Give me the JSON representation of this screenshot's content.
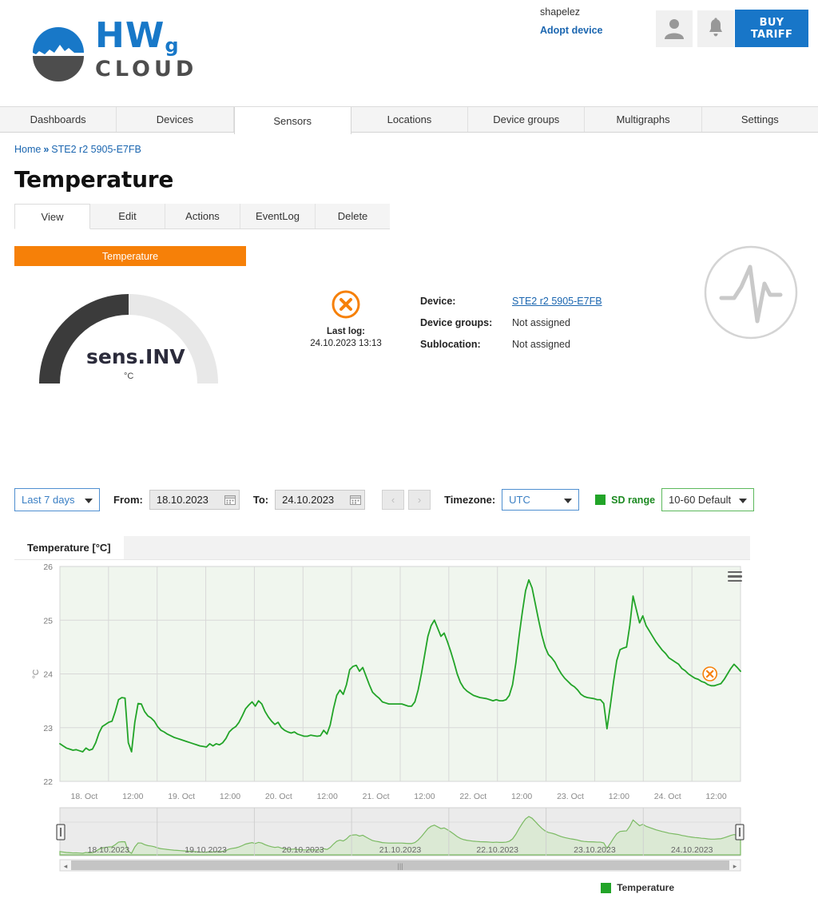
{
  "header": {
    "logo_hw": "HW",
    "logo_sub": "g",
    "logo_cloud": "CLOUD",
    "user_name": "shapelez",
    "adopt_device": "Adopt device",
    "buy_tariff": "BUY TARIFF",
    "avatar_icon": "user-icon",
    "bell_icon": "bell-icon"
  },
  "mainnav": {
    "items": [
      {
        "label": "Dashboards",
        "active": false
      },
      {
        "label": "Devices",
        "active": false
      },
      {
        "label": "Sensors",
        "active": true
      },
      {
        "label": "Locations",
        "active": false
      },
      {
        "label": "Device groups",
        "active": false
      },
      {
        "label": "Multigraphs",
        "active": false
      },
      {
        "label": "Settings",
        "active": false
      }
    ]
  },
  "breadcrumb": {
    "home": "Home",
    "separator": "»",
    "current": "STE2 r2 5905-E7FB"
  },
  "page_title": "Temperature",
  "subtabs": {
    "items": [
      {
        "label": "View",
        "active": true
      },
      {
        "label": "Edit",
        "active": false
      },
      {
        "label": "Actions",
        "active": false
      },
      {
        "label": "EventLog",
        "active": false
      },
      {
        "label": "Delete",
        "active": false
      }
    ]
  },
  "sensor_pill": "Temperature",
  "gauge": {
    "value": "sens.INV",
    "unit": "°C",
    "fill_color": "#3b3b3b",
    "track_color": "#e8e8e8"
  },
  "status": {
    "icon": "error-x-circle-icon",
    "last_log_label": "Last log:",
    "last_log_time": "24.10.2023 13:13",
    "accent_color": "#f68008"
  },
  "info": {
    "rows": [
      {
        "key": "Device:",
        "value": "STE2 r2 5905-E7FB",
        "is_link": true
      },
      {
        "key": "Device groups:",
        "value": "Not assigned",
        "is_link": false
      },
      {
        "key": "Sublocation:",
        "value": "Not assigned",
        "is_link": false
      }
    ]
  },
  "controls": {
    "range_select": "Last 7 days",
    "from_label": "From:",
    "from_value": "18.10.2023",
    "to_label": "To:",
    "to_value": "24.10.2023",
    "prev_arrow": "‹",
    "next_arrow": "›",
    "timezone_label": "Timezone:",
    "timezone_value": "UTC",
    "sd_range_label": "SD range",
    "sd_range_color": "#22a428",
    "sd_select": "10-60 Default"
  },
  "chart_tab_label": "Temperature [°C]",
  "legend": {
    "label": "Temperature",
    "color": "#22a428"
  },
  "navigator": {
    "dates": [
      "18.10.2023",
      "19.10.2023",
      "20.10.2023",
      "21.10.2023",
      "22.10.2023",
      "23.10.2023",
      "24.10.2023"
    ]
  },
  "chart_data": {
    "type": "line",
    "title": "Temperature [°C]",
    "xlabel": "",
    "ylabel": "°C",
    "ylim": [
      22,
      26
    ],
    "yticks": [
      22,
      23,
      24,
      25,
      26
    ],
    "grid": true,
    "legend_position": "bottom-right",
    "xticks": [
      "18. Oct",
      "12:00",
      "19. Oct",
      "12:00",
      "20. Oct",
      "12:00",
      "21. Oct",
      "12:00",
      "22. Oct",
      "12:00",
      "23. Oct",
      "12:00",
      "24. Oct",
      "12:00"
    ],
    "series": [
      {
        "name": "Temperature",
        "color": "#22a428",
        "values": [
          22.7,
          22.66,
          22.62,
          22.6,
          22.58,
          22.59,
          22.57,
          22.55,
          22.62,
          22.58,
          22.6,
          22.72,
          22.9,
          23.02,
          23.06,
          23.1,
          23.12,
          23.3,
          23.52,
          23.56,
          23.55,
          22.72,
          22.55,
          23.1,
          23.45,
          23.44,
          23.3,
          23.22,
          23.18,
          23.12,
          23.02,
          22.95,
          22.92,
          22.88,
          22.85,
          22.82,
          22.8,
          22.78,
          22.76,
          22.74,
          22.72,
          22.7,
          22.68,
          22.66,
          22.65,
          22.64,
          22.7,
          22.66,
          22.7,
          22.68,
          22.72,
          22.8,
          22.92,
          22.98,
          23.02,
          23.1,
          23.22,
          23.35,
          23.42,
          23.48,
          23.4,
          23.5,
          23.44,
          23.3,
          23.2,
          23.12,
          23.06,
          23.1,
          23.0,
          22.95,
          22.92,
          22.9,
          22.92,
          22.88,
          22.86,
          22.84,
          22.84,
          22.86,
          22.85,
          22.84,
          22.85,
          22.95,
          22.88,
          23.05,
          23.35,
          23.6,
          23.7,
          23.62,
          23.8,
          24.08,
          24.14,
          24.16,
          24.05,
          24.12,
          23.96,
          23.8,
          23.66,
          23.6,
          23.55,
          23.48,
          23.46,
          23.44,
          23.44,
          23.44,
          23.44,
          23.44,
          23.42,
          23.4,
          23.4,
          23.48,
          23.7,
          24.0,
          24.35,
          24.7,
          24.9,
          25.0,
          24.85,
          24.7,
          24.76,
          24.6,
          24.42,
          24.22,
          24.0,
          23.84,
          23.74,
          23.68,
          23.64,
          23.6,
          23.58,
          23.56,
          23.55,
          23.54,
          23.52,
          23.5,
          23.52,
          23.5,
          23.5,
          23.52,
          23.6,
          23.8,
          24.2,
          24.7,
          25.15,
          25.55,
          25.75,
          25.6,
          25.3,
          25.0,
          24.72,
          24.5,
          24.36,
          24.3,
          24.22,
          24.1,
          24.0,
          23.92,
          23.86,
          23.8,
          23.76,
          23.7,
          23.62,
          23.58,
          23.56,
          23.55,
          23.54,
          23.52,
          23.52,
          23.45,
          22.98,
          23.4,
          23.85,
          24.25,
          24.45,
          24.48,
          24.5,
          24.9,
          25.45,
          25.2,
          24.95,
          25.08,
          24.9,
          24.8,
          24.7,
          24.6,
          24.52,
          24.44,
          24.38,
          24.3,
          24.26,
          24.22,
          24.18,
          24.1,
          24.06,
          24.0,
          23.96,
          23.92,
          23.9,
          23.86,
          23.84,
          23.8,
          23.78,
          23.78,
          23.8,
          23.82,
          23.9,
          24.0,
          24.1,
          24.18,
          24.12,
          24.05
        ]
      }
    ],
    "marker_annotation": {
      "icon": "error-x-circle-icon",
      "color": "#f68008",
      "x_position_ratio": 0.955,
      "y_value": 24.0
    }
  }
}
